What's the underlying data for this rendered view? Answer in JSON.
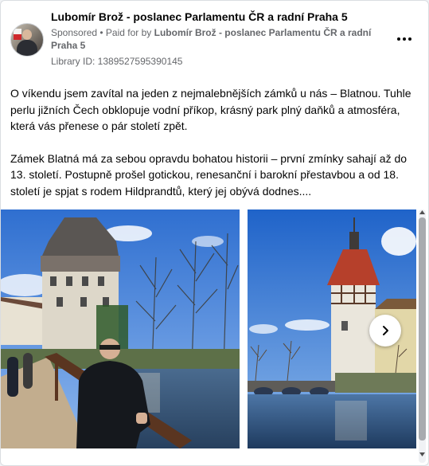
{
  "header": {
    "page_name": "Lubomír Brož - poslanec Parlamentu ČR a radní Praha 5",
    "sponsored_label": "Sponsored",
    "separator": " • ",
    "paid_prefix": "Paid for by ",
    "paid_by": "Lubomír Brož - poslanec Parlamentu ČR a radní Praha 5",
    "library_id": "Library ID: 1389527595390145",
    "more_icon": "more-horizontal-icon"
  },
  "post": {
    "paragraph1": "O víkendu jsem zavítal na jeden z nejmalebnějších zámků u nás – Blatnou. Tuhle perlu jižních Čech obklopuje vodní příkop, krásný park plný daňků a atmosféra, která vás přenese o pár století zpět.",
    "paragraph2": "Zámek Blatná má za sebou opravdu bohatou historii – první zmínky sahají až do 13. století. Postupně prošel gotickou, renesanční i barokní přestavbou a od 18. století je spjat s rodem Hildprandtů, který jej obývá dodnes...."
  },
  "carousel": {
    "next_icon": "chevron-right-icon"
  },
  "colors": {
    "text": "#050505",
    "secondary": "#65676b",
    "sky": "#3f7fd8",
    "water": "#2c4f78"
  }
}
